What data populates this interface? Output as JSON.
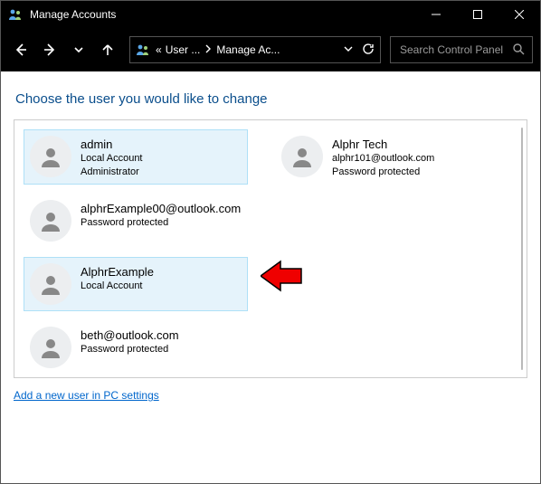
{
  "window": {
    "title": "Manage Accounts"
  },
  "breadcrumb": {
    "prefix": "«",
    "item1": "User ...",
    "item2": "Manage Ac..."
  },
  "search": {
    "placeholder": "Search Control Panel"
  },
  "heading": "Choose the user you would like to change",
  "accounts": [
    {
      "name": "admin",
      "line1": "Local Account",
      "line2": "Administrator",
      "selected": true
    },
    {
      "name": "Alphr Tech",
      "line1": "alphr101@outlook.com",
      "line2": "Password protected",
      "selected": false
    },
    {
      "name": "alphrExample00@outlook.com",
      "line1": "Password protected",
      "line2": "",
      "selected": false
    },
    {
      "name": "AlphrExample",
      "line1": "Local Account",
      "line2": "",
      "selected": true
    },
    {
      "name": "beth@outlook.com",
      "line1": "Password protected",
      "line2": "",
      "selected": false
    }
  ],
  "add_user_link": "Add a new user in PC settings"
}
